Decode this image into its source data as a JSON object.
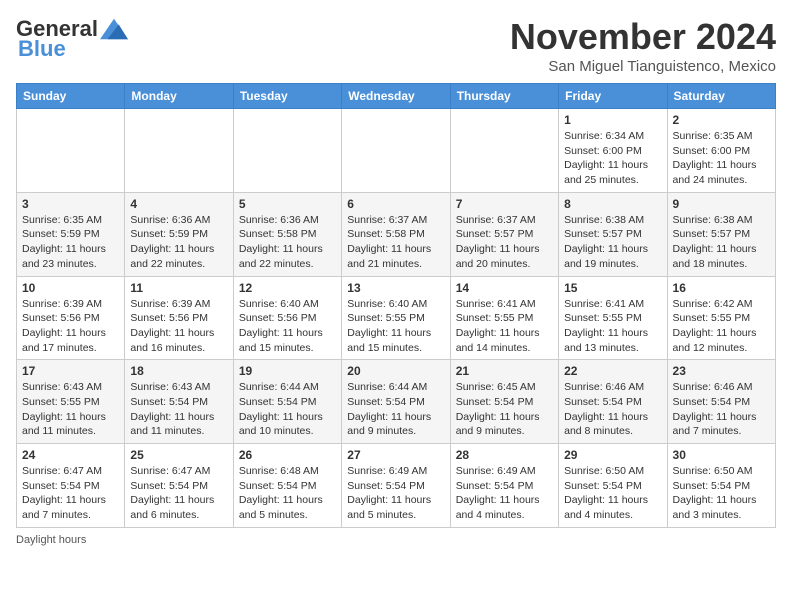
{
  "header": {
    "logo_general": "General",
    "logo_blue": "Blue",
    "month_title": "November 2024",
    "location": "San Miguel Tianguistenco, Mexico"
  },
  "weekdays": [
    "Sunday",
    "Monday",
    "Tuesday",
    "Wednesday",
    "Thursday",
    "Friday",
    "Saturday"
  ],
  "footer": {
    "daylight_label": "Daylight hours"
  },
  "weeks": [
    [
      {
        "day": "",
        "info": ""
      },
      {
        "day": "",
        "info": ""
      },
      {
        "day": "",
        "info": ""
      },
      {
        "day": "",
        "info": ""
      },
      {
        "day": "",
        "info": ""
      },
      {
        "day": "1",
        "info": "Sunrise: 6:34 AM\nSunset: 6:00 PM\nDaylight: 11 hours and 25 minutes."
      },
      {
        "day": "2",
        "info": "Sunrise: 6:35 AM\nSunset: 6:00 PM\nDaylight: 11 hours and 24 minutes."
      }
    ],
    [
      {
        "day": "3",
        "info": "Sunrise: 6:35 AM\nSunset: 5:59 PM\nDaylight: 11 hours and 23 minutes."
      },
      {
        "day": "4",
        "info": "Sunrise: 6:36 AM\nSunset: 5:59 PM\nDaylight: 11 hours and 22 minutes."
      },
      {
        "day": "5",
        "info": "Sunrise: 6:36 AM\nSunset: 5:58 PM\nDaylight: 11 hours and 22 minutes."
      },
      {
        "day": "6",
        "info": "Sunrise: 6:37 AM\nSunset: 5:58 PM\nDaylight: 11 hours and 21 minutes."
      },
      {
        "day": "7",
        "info": "Sunrise: 6:37 AM\nSunset: 5:57 PM\nDaylight: 11 hours and 20 minutes."
      },
      {
        "day": "8",
        "info": "Sunrise: 6:38 AM\nSunset: 5:57 PM\nDaylight: 11 hours and 19 minutes."
      },
      {
        "day": "9",
        "info": "Sunrise: 6:38 AM\nSunset: 5:57 PM\nDaylight: 11 hours and 18 minutes."
      }
    ],
    [
      {
        "day": "10",
        "info": "Sunrise: 6:39 AM\nSunset: 5:56 PM\nDaylight: 11 hours and 17 minutes."
      },
      {
        "day": "11",
        "info": "Sunrise: 6:39 AM\nSunset: 5:56 PM\nDaylight: 11 hours and 16 minutes."
      },
      {
        "day": "12",
        "info": "Sunrise: 6:40 AM\nSunset: 5:56 PM\nDaylight: 11 hours and 15 minutes."
      },
      {
        "day": "13",
        "info": "Sunrise: 6:40 AM\nSunset: 5:55 PM\nDaylight: 11 hours and 15 minutes."
      },
      {
        "day": "14",
        "info": "Sunrise: 6:41 AM\nSunset: 5:55 PM\nDaylight: 11 hours and 14 minutes."
      },
      {
        "day": "15",
        "info": "Sunrise: 6:41 AM\nSunset: 5:55 PM\nDaylight: 11 hours and 13 minutes."
      },
      {
        "day": "16",
        "info": "Sunrise: 6:42 AM\nSunset: 5:55 PM\nDaylight: 11 hours and 12 minutes."
      }
    ],
    [
      {
        "day": "17",
        "info": "Sunrise: 6:43 AM\nSunset: 5:55 PM\nDaylight: 11 hours and 11 minutes."
      },
      {
        "day": "18",
        "info": "Sunrise: 6:43 AM\nSunset: 5:54 PM\nDaylight: 11 hours and 11 minutes."
      },
      {
        "day": "19",
        "info": "Sunrise: 6:44 AM\nSunset: 5:54 PM\nDaylight: 11 hours and 10 minutes."
      },
      {
        "day": "20",
        "info": "Sunrise: 6:44 AM\nSunset: 5:54 PM\nDaylight: 11 hours and 9 minutes."
      },
      {
        "day": "21",
        "info": "Sunrise: 6:45 AM\nSunset: 5:54 PM\nDaylight: 11 hours and 9 minutes."
      },
      {
        "day": "22",
        "info": "Sunrise: 6:46 AM\nSunset: 5:54 PM\nDaylight: 11 hours and 8 minutes."
      },
      {
        "day": "23",
        "info": "Sunrise: 6:46 AM\nSunset: 5:54 PM\nDaylight: 11 hours and 7 minutes."
      }
    ],
    [
      {
        "day": "24",
        "info": "Sunrise: 6:47 AM\nSunset: 5:54 PM\nDaylight: 11 hours and 7 minutes."
      },
      {
        "day": "25",
        "info": "Sunrise: 6:47 AM\nSunset: 5:54 PM\nDaylight: 11 hours and 6 minutes."
      },
      {
        "day": "26",
        "info": "Sunrise: 6:48 AM\nSunset: 5:54 PM\nDaylight: 11 hours and 5 minutes."
      },
      {
        "day": "27",
        "info": "Sunrise: 6:49 AM\nSunset: 5:54 PM\nDaylight: 11 hours and 5 minutes."
      },
      {
        "day": "28",
        "info": "Sunrise: 6:49 AM\nSunset: 5:54 PM\nDaylight: 11 hours and 4 minutes."
      },
      {
        "day": "29",
        "info": "Sunrise: 6:50 AM\nSunset: 5:54 PM\nDaylight: 11 hours and 4 minutes."
      },
      {
        "day": "30",
        "info": "Sunrise: 6:50 AM\nSunset: 5:54 PM\nDaylight: 11 hours and 3 minutes."
      }
    ]
  ]
}
